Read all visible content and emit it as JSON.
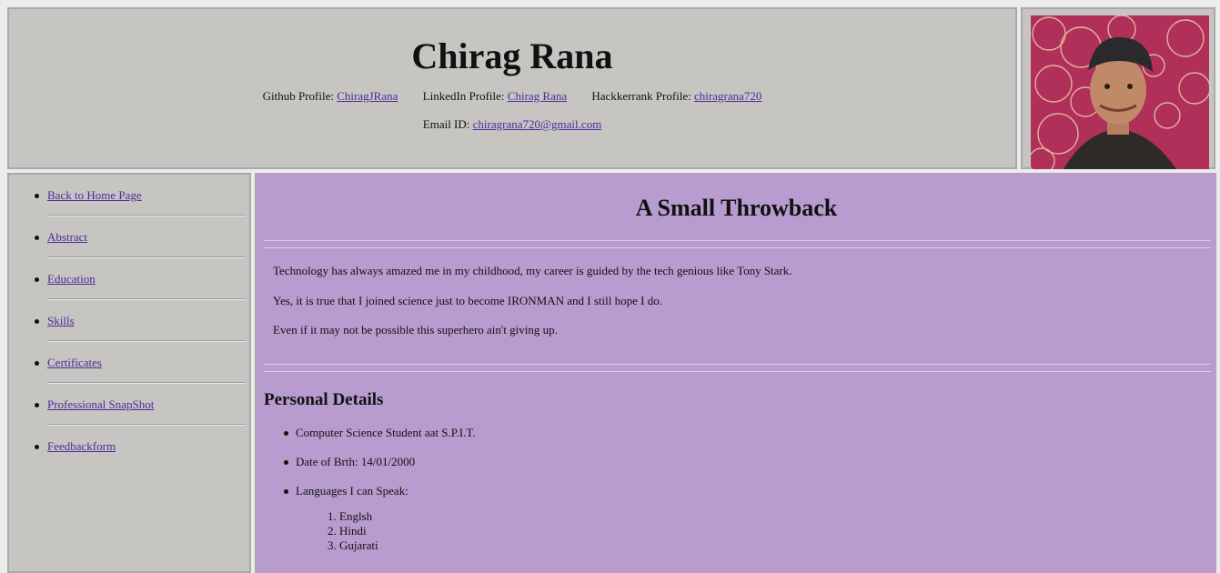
{
  "header": {
    "name": "Chirag Rana",
    "github": {
      "label": "Github Profile: ",
      "link": "ChiragJRana"
    },
    "linkedin": {
      "label": "LinkedIn Profile: ",
      "link": "Chirag Rana"
    },
    "hackerrank": {
      "label": "Hackkerrank Profile: ",
      "link": "chiragrana720"
    },
    "email": {
      "label": "Email ID: ",
      "link": "chiragrana720@gmail.com"
    }
  },
  "sidebar": {
    "items": [
      {
        "label": "Back to Home Page"
      },
      {
        "label": "Abstract"
      },
      {
        "label": "Education"
      },
      {
        "label": "Skills"
      },
      {
        "label": "Certificates"
      },
      {
        "label": "Professional SnapShot"
      },
      {
        "label": "Feedbackform"
      }
    ]
  },
  "main": {
    "title": "A Small Throwback",
    "paragraphs": [
      "Technology has always amazed me in my childhood, my career is guided by the tech genious like Tony Stark.",
      "Yes, it is true that I joined science just to become IRONMAN and I still hope I do.",
      "Even if it may not be possible this superhero ain't giving up."
    ],
    "details_title": "Personal Details",
    "details": [
      "Computer Science Student aat S.P.I.T.",
      "Date of Brth: 14/01/2000",
      "Languages I can Speak:"
    ],
    "languages": [
      "1. Englsh",
      "2. Hindi",
      "3. Gujarati"
    ]
  },
  "colors": {
    "header_bg": "#c6c5c2",
    "main_bg": "#b89bcf",
    "link": "#4b2c9a"
  }
}
